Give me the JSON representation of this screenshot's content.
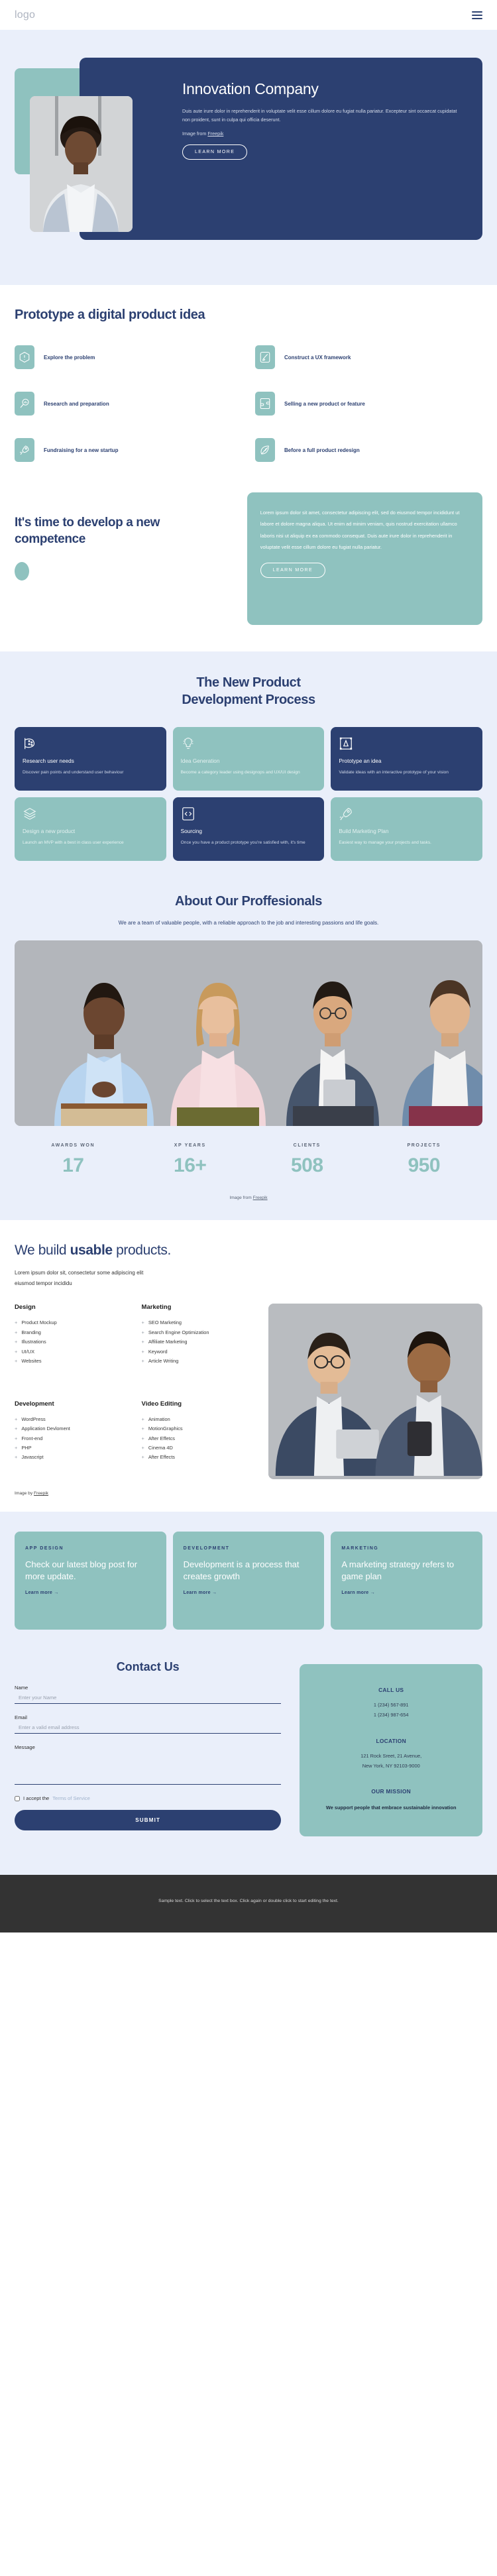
{
  "header": {
    "logo": "logo",
    "menu_icon": "hamburger-icon"
  },
  "hero": {
    "title": "Innovation Company",
    "paragraph": "Duis aute irure dolor in reprehenderit in voluptate velit esse cillum dolore eu fugiat nulla pariatur. Excepteur sint occaecat cupidatat non proident, sunt in culpa qui officia deserunt.",
    "credit_prefix": "Image from ",
    "credit_link": "Freepik",
    "cta": "LEARN MORE"
  },
  "prototype": {
    "title": "Prototype a digital product idea",
    "items": [
      {
        "label": "Explore the problem",
        "icon": "alert-hexagon-icon"
      },
      {
        "label": "Construct a UX framework",
        "icon": "brush-icon"
      },
      {
        "label": "Research and preparation",
        "icon": "magnifier-chart-icon"
      },
      {
        "label": "Selling a new product or feature",
        "icon": "puzzle-icon"
      },
      {
        "label": "Fundraising for a new startup",
        "icon": "rocket-icon"
      },
      {
        "label": "Before a full product redesign",
        "icon": "leaf-icon"
      }
    ]
  },
  "competence": {
    "title": "It's time to develop a new competence",
    "paragraph": "Lorem ipsum dolor sit amet, consectetur adipiscing elit, sed do eiusmod tempor incididunt ut labore et dolore magna aliqua. Ut enim ad minim veniam, quis nostrud exercitation ullamco laboris nisi ut aliquip ex ea commodo consequat. Duis aute irure dolor in reprehenderit in voluptate velit esse cillum dolore eu fugiat nulla pariatur.",
    "cta": "LEARN MORE"
  },
  "process": {
    "title_line1": "The New Product",
    "title_line2": "Development Process",
    "cards": [
      {
        "heading": "Research user needs",
        "body": "Discover pain points and understand user behaviour",
        "theme": "navy",
        "icon": "palette-icon"
      },
      {
        "heading": "Idea Generation",
        "body": "Become a category leader using designops and UX/UI design",
        "theme": "teal",
        "icon": "lightbulb-icon"
      },
      {
        "heading": "Prototype an idea",
        "body": "Validate ideas with an interactive prototype of your vision",
        "theme": "navy",
        "icon": "pen-tool-icon"
      },
      {
        "heading": "Design a new product",
        "body": "Launch an MVP with a best in class user experience",
        "theme": "teal",
        "icon": "layers-icon"
      },
      {
        "heading": "Sourcing",
        "body": "Once you have a product prototype you're satisfied with, it's time",
        "theme": "navy",
        "icon": "code-icon"
      },
      {
        "heading": "Build Marketing Plan",
        "body": "Easiest way to manage your projects and tasks.",
        "theme": "teal",
        "icon": "rocket-icon"
      }
    ]
  },
  "about": {
    "title": "About Our Proffesionals",
    "subtitle": "We are a team of valuable people, with a reliable approach to the job and interesting passions and life goals.",
    "stats": [
      {
        "label": "AWARDS WON",
        "value": "17"
      },
      {
        "label": "XP YEARS",
        "value": "16+"
      },
      {
        "label": "CLIENTS",
        "value": "508"
      },
      {
        "label": "PROJECTS",
        "value": "950"
      }
    ],
    "credit_prefix": "Image from ",
    "credit_link": "Freepik"
  },
  "usable": {
    "title_pre": "We build ",
    "title_bold": "usable",
    "title_post": " products.",
    "subtitle": "Lorem ipsum dolor sit, consectetur some adipiscing elit eiusmod tempor incididu",
    "groups": [
      {
        "heading": "Design",
        "items": [
          "Product Mockup",
          "Branding",
          "Illustrations",
          "UI/UX",
          "Websites"
        ]
      },
      {
        "heading": "Marketing",
        "items": [
          "SEO Marketing",
          "Search Engine Optimization",
          "Affiliate Marketing",
          "Keyword",
          "Article Writing"
        ]
      },
      {
        "heading": "Development",
        "items": [
          "WordPress",
          "Application Devloment",
          "Front-end",
          "PHP",
          "Javascript"
        ]
      },
      {
        "heading": "Video Editing",
        "items": [
          "Animation",
          "MotionGraphics",
          "After Effetcs",
          "Cinema 4D",
          "After Effects"
        ]
      }
    ],
    "credit_prefix": "Image by ",
    "credit_link": "Freepik"
  },
  "blog": {
    "cards": [
      {
        "category": "APP DESIGN",
        "title": "Check our latest blog post for more update.",
        "link": "Learn more  →"
      },
      {
        "category": "DEVELOPMENT",
        "title": "Development is a process that creates growth",
        "link": "Learn more  →"
      },
      {
        "category": "MARKETING",
        "title": "A marketing strategy refers to game plan",
        "link": "Learn more  →"
      }
    ]
  },
  "contact": {
    "title": "Contact Us",
    "name_label": "Name",
    "name_placeholder": "Enter your Name",
    "name_value": "",
    "email_label": "Email",
    "email_placeholder": "Enter a valid email address",
    "email_value": "",
    "message_label": "Message",
    "message_placeholder": "",
    "message_value": "",
    "terms_text": "I accept the ",
    "terms_link": "Terms of Service",
    "submit": "SUBMIT",
    "info": [
      {
        "title": "CALL US",
        "lines": "1 (234) 567-891\n1 (234) 987-654",
        "bold": false
      },
      {
        "title": "LOCATION",
        "lines": "121 Rock Sreet, 21 Avenue,\nNew York, NY 92103-9000",
        "bold": false
      },
      {
        "title": "OUR MISSION",
        "lines": "We support people that embrace sustainable innovation",
        "bold": true
      }
    ]
  },
  "footer": {
    "text": "Sample text. Click to select the text box. Click again or double click to start editing the text."
  },
  "colors": {
    "navy": "#2c4071",
    "teal": "#8fc2bf",
    "page_blue": "#eaeffa",
    "footer_dark": "#333333"
  }
}
